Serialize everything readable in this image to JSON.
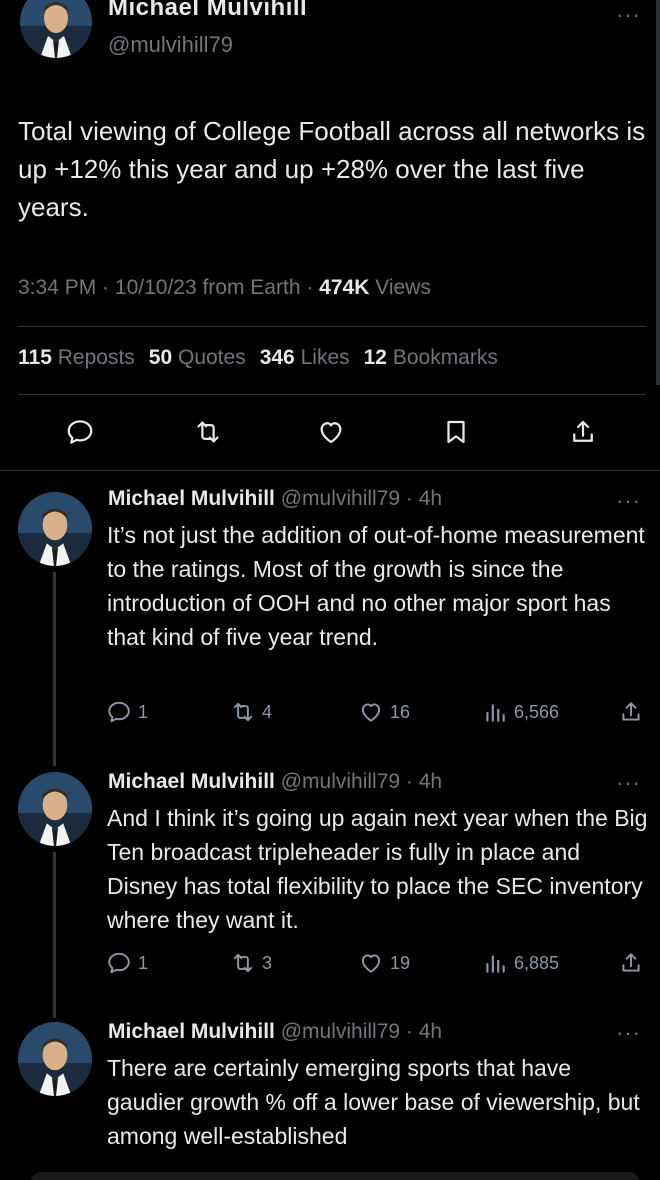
{
  "main_tweet": {
    "author_name": "Michael Mulvihill",
    "handle": "@mulvihill79",
    "text": "Total viewing of College Football across all networks is up +12% this year and up +28% over the last five years.",
    "time": "3:34 PM",
    "date": "10/10/23 from Earth",
    "views_count": "474K",
    "views_label": "Views",
    "stats": [
      {
        "count": "115",
        "label": "Reposts"
      },
      {
        "count": "50",
        "label": "Quotes"
      },
      {
        "count": "346",
        "label": "Likes"
      },
      {
        "count": "12",
        "label": "Bookmarks"
      }
    ]
  },
  "replies": [
    {
      "author_name": "Michael Mulvihill",
      "handle": "@mulvihill79",
      "age": "4h",
      "text": "It’s not just the addition of out-of-home measurement to the ratings. Most of the growth is since the introduction of OOH and no other major sport has that kind of five year trend.",
      "replies": "1",
      "reposts": "4",
      "likes": "16",
      "views": "6,566"
    },
    {
      "author_name": "Michael Mulvihill",
      "handle": "@mulvihill79",
      "age": "4h",
      "text": "And I think it’s going up again next year when the Big Ten broadcast tripleheader is fully in place and Disney has total flexibility to place the SEC inventory where they want it.",
      "replies": "1",
      "reposts": "3",
      "likes": "19",
      "views": "6,885"
    },
    {
      "author_name": "Michael Mulvihill",
      "handle": "@mulvihill79",
      "age": "4h",
      "text": "There are certainly emerging sports that have gaudier growth % off a lower base of viewership, but among well-established",
      "replies": "",
      "reposts": "",
      "likes": "",
      "views": ""
    }
  ],
  "more_glyph": "···",
  "colors": {
    "background": "#000000",
    "text": "#e7e9ea",
    "secondary": "#71767b",
    "divider": "#2f3336"
  }
}
